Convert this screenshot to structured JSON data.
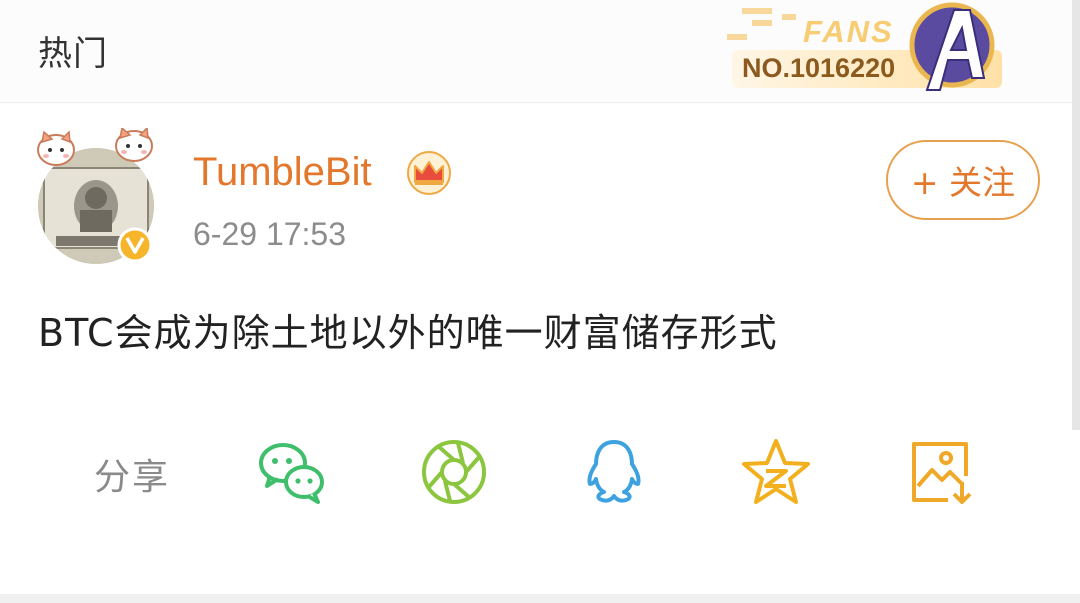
{
  "header": {
    "hot_label": "热门",
    "fans_badge": {
      "word": "FANS",
      "number": "NO.1016220"
    }
  },
  "post": {
    "username": "TumbleBit",
    "timestamp": "6-29 17:53",
    "follow_label": "+ 关注",
    "text": "BTC会成为除土地以外的唯一财富储存形式"
  },
  "share": {
    "label": "分享",
    "icons": [
      "wechat-icon",
      "moments-icon",
      "qq-icon",
      "qzone-icon",
      "save-image-icon"
    ]
  },
  "colors": {
    "accent": "#e3772b",
    "follow_border": "#e8a04e",
    "wechat": "#3fbf6c",
    "moments": "#8cc63f",
    "qq": "#3fa2e0",
    "qzone": "#f2b01e",
    "save": "#f0a828"
  }
}
